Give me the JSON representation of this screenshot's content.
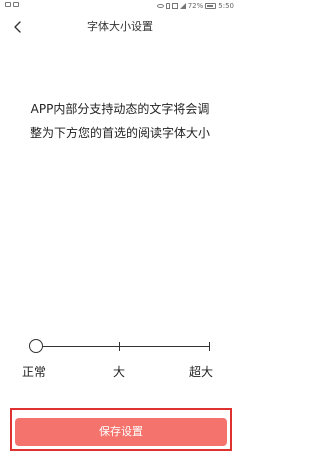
{
  "status_bar": {
    "battery": "72%",
    "time": "5:50"
  },
  "header": {
    "title": "字体大小设置",
    "back_icon": "chevron-left-icon"
  },
  "description": {
    "line1": "APP内部分支持动态的文字将会调",
    "line2": "整为下方您的首选的阅读字体大小"
  },
  "font_size": {
    "options": [
      "正常",
      "大",
      "超大"
    ],
    "selected": "正常",
    "selected_index": 0
  },
  "save_button": {
    "label": "保存设置"
  },
  "colors": {
    "button_bg": "#f5736d",
    "highlight_border": "#e03131",
    "text": "#222222"
  }
}
